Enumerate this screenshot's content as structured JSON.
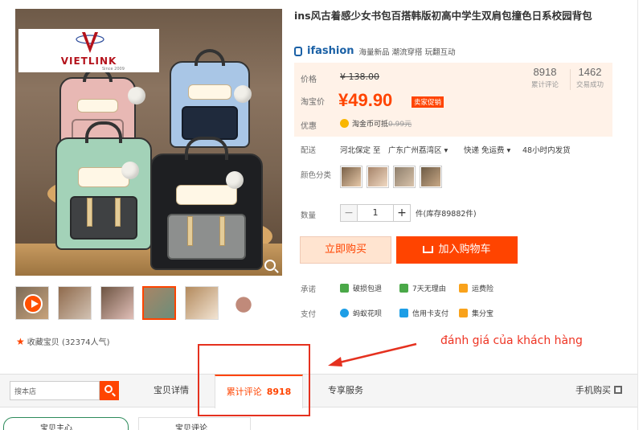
{
  "product": {
    "title": "ins风古着感少女书包百搭韩版初高中学生双肩包撞色日系校园背包",
    "brand_name": "ifashion",
    "brand_tags": "海量新品 潮流穿搭 玩翻互动"
  },
  "watermark": {
    "name": "VIETLINK",
    "since": "Since 2009"
  },
  "price": {
    "label": "价格",
    "old": "¥ 138.00",
    "taobao_label": "淘宝价",
    "current": "¥49.90",
    "promo": "卖家促销"
  },
  "stats": [
    {
      "num": "8918",
      "label": "累计评论"
    },
    {
      "num": "1462",
      "label": "交易成功"
    }
  ],
  "discount": {
    "label": "优惠",
    "text": "淘金币可抵",
    "amount": "0.99元"
  },
  "shipping": {
    "label": "配送",
    "from": "河北保定 至",
    "to": "广东广州荔湾区 ▾",
    "method": "快递 免运费 ▾",
    "time": "48小时内发货"
  },
  "color": {
    "label": "颜色分类",
    "swatch_colors": [
      "#7a6148",
      "#a6846a",
      "#8e7f6c",
      "#6d5b45"
    ]
  },
  "quantity": {
    "label": "数量",
    "minus": "−",
    "value": "1",
    "plus": "+",
    "stock": "件(库存89882件)"
  },
  "actions": {
    "buy_now": "立即购买",
    "add_cart": "加入购物车"
  },
  "promise": {
    "label": "承诺",
    "items": [
      {
        "text": "破损包退",
        "color": "#4aa848"
      },
      {
        "text": "7天无理由",
        "color": "#4aa848"
      },
      {
        "text": "运费险",
        "color": "#f9a21b"
      }
    ]
  },
  "payment": {
    "label": "支付",
    "items": [
      {
        "text": "蚂蚁花呗",
        "color": "#1d9ee6"
      },
      {
        "text": "信用卡支付",
        "color": "#1d9ee6"
      },
      {
        "text": "集分宝",
        "color": "#f9a21b"
      }
    ]
  },
  "favorite": {
    "text": "收藏宝贝",
    "count": "(32374人气)"
  },
  "annotation": {
    "text": "đánh giá của khách hàng"
  },
  "tabs": {
    "search_placeholder": "搜本店",
    "items": [
      {
        "label": "宝贝详情"
      },
      {
        "label": "累计评论",
        "count": "8918"
      },
      {
        "label": "专享服务"
      }
    ],
    "mobile": "手机购买"
  },
  "bottom": {
    "left": "宝贝主心",
    "right": "宝贝评论"
  },
  "thumb_colors": [
    "#c7a27a",
    "#a88566",
    "#8f6a4c",
    "#6d5442",
    "#b38a5d",
    "#9c7a64"
  ]
}
